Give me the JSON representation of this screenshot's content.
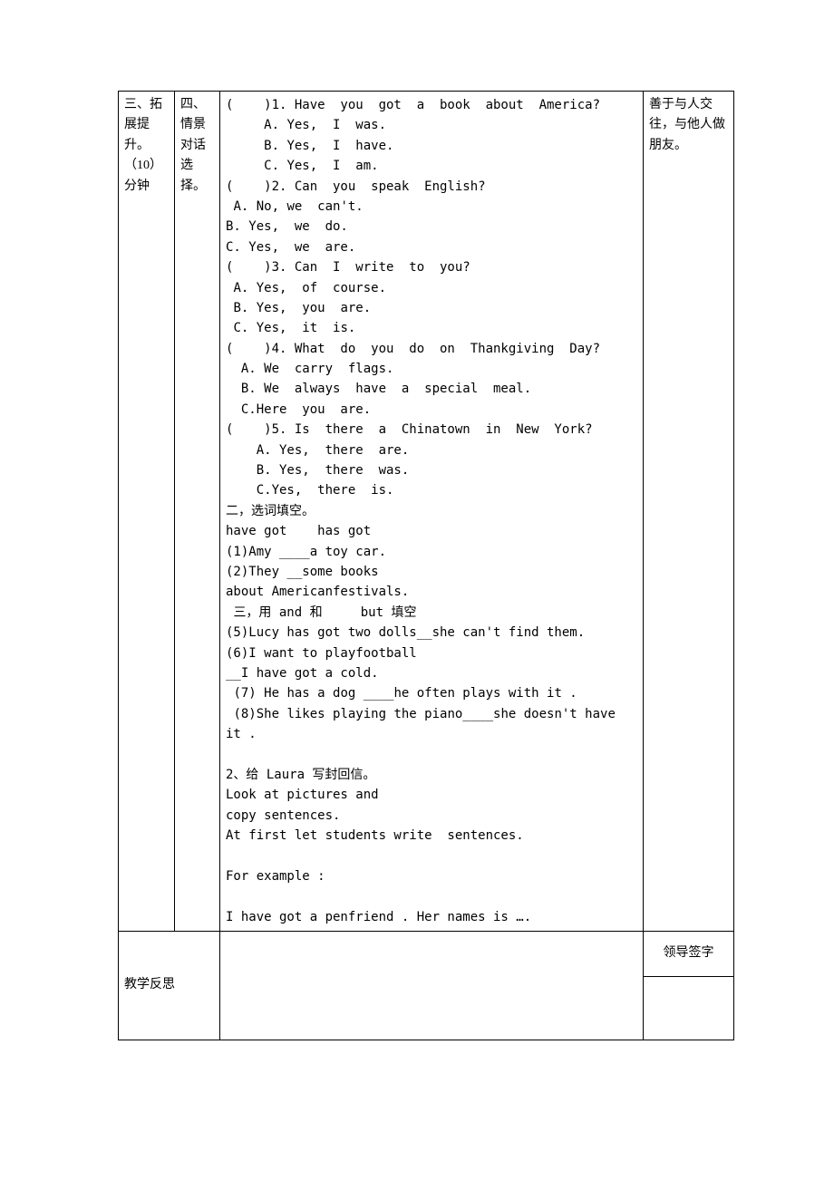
{
  "row1": {
    "colA": "三、拓展提升。\n（10）分钟",
    "colB": "四、情景对话选择。",
    "colC": "(    )1. Have  you  got  a  book  about  America?\n     A. Yes,  I  was.\n     B. Yes,  I  have.\n     C. Yes,  I  am.\n(    )2. Can  you  speak  English?\n A. No, we  can't.\nB. Yes,  we  do.\nC. Yes,  we  are.\n(    )3. Can  I  write  to  you?\n A. Yes,  of  course.\n B. Yes,  you  are.\n C. Yes,  it  is.\n(    )4. What  do  you  do  on  Thankgiving  Day?\n  A. We  carry  flags.\n  B. We  always  have  a  special  meal.\n  C.Here  you  are.\n(    )5. Is  there  a  Chinatown  in  New  York?\n    A. Yes,  there  are.\n    B. Yes,  there  was.\n    C.Yes,  there  is.\n二，选词填空。\nhave got    has got\n(1)Amy ____a toy car.\n(2)They __some books\nabout Americanfestivals.\n 三，用 and 和     but 填空\n(5)Lucy has got two dolls__she can't find them.\n(6)I want to playfootball\n__I have got a cold.\n (7) He has a dog ____he often plays with it .\n (8)She likes playing the piano____she doesn't have it .\n\n2、给 Laura 写封回信。\nLook at pictures and\ncopy sentences.\nAt first let students write  sentences.\n\nFor example :\n\nI have got a penfriend . Her names is ….",
    "colD": "善于与人交往，与他人做朋友。"
  },
  "row2": {
    "colA": "教学反思",
    "colD_top": "领导签字"
  }
}
